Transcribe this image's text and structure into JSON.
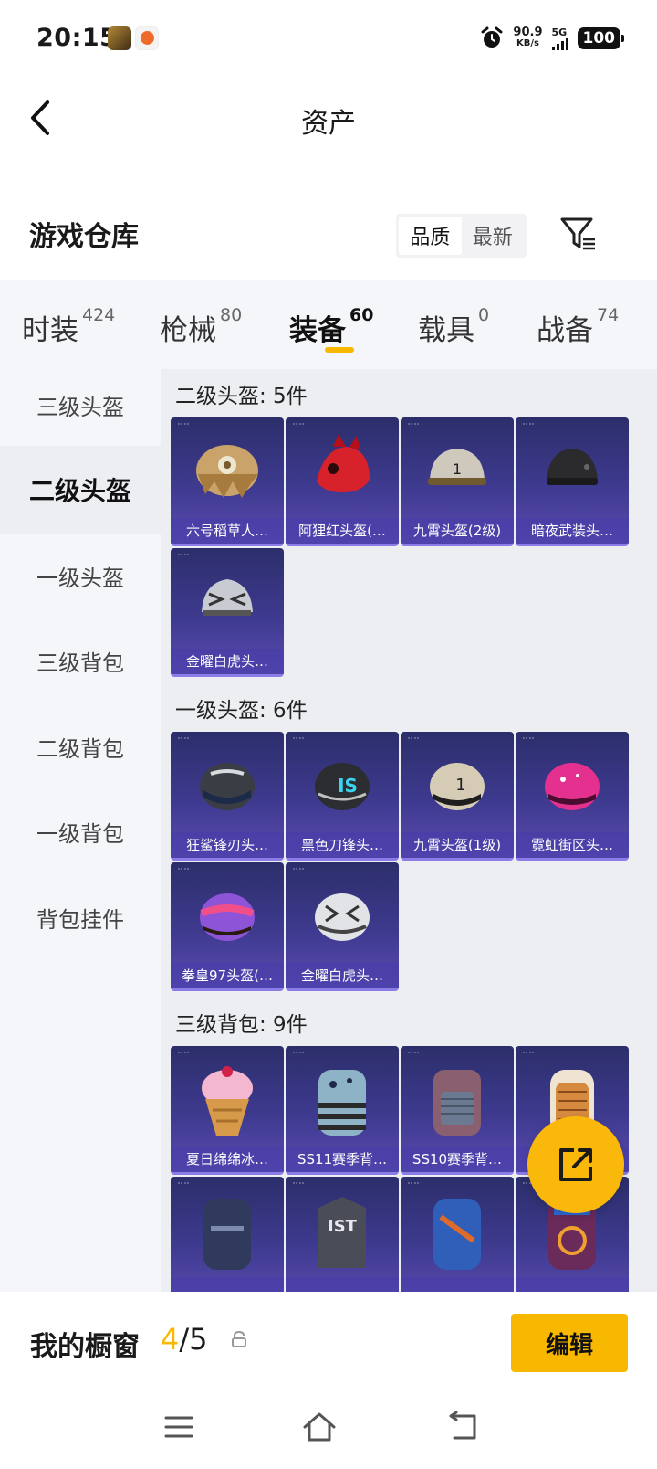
{
  "status_bar": {
    "time": "20:15",
    "net_speed_value": "90.9",
    "net_speed_unit": "KB/s",
    "network": "5G",
    "battery": "100"
  },
  "header": {
    "title": "资产"
  },
  "warehouse": {
    "title": "游戏仓库",
    "sort_options": [
      "品质",
      "最新"
    ],
    "active_sort": "品质"
  },
  "tabs": [
    {
      "label": "时装",
      "count": "424"
    },
    {
      "label": "枪械",
      "count": "80"
    },
    {
      "label": "装备",
      "count": "60"
    },
    {
      "label": "载具",
      "count": "0"
    },
    {
      "label": "战备",
      "count": "74"
    }
  ],
  "active_tab": "装备",
  "sidebar": {
    "items": [
      "三级头盔",
      "二级头盔",
      "一级头盔",
      "三级背包",
      "二级背包",
      "一级背包",
      "背包挂件"
    ],
    "active": "二级头盔"
  },
  "groups": [
    {
      "title": "二级头盔: 5件",
      "items": [
        "六号稻草人…",
        "阿狸红头盔(…",
        "九霄头盔(2级)",
        "暗夜武装头…",
        "金曜白虎头…"
      ]
    },
    {
      "title": "一级头盔: 6件",
      "items": [
        "狂鲨锋刃头…",
        "黑色刀锋头…",
        "九霄头盔(1级)",
        "霓虹街区头…",
        "拳皇97头盔(…",
        "金曜白虎头…"
      ]
    },
    {
      "title": "三级背包: 9件",
      "items": [
        "夏日绵绵冰…",
        "SS11赛季背…",
        "SS10赛季背…",
        "",
        "",
        "",
        "",
        ""
      ]
    }
  ],
  "bottom_bar": {
    "label": "我的橱窗",
    "current": "4",
    "separator": "/",
    "total": "5",
    "edit_label": "编辑"
  },
  "colors": {
    "accent": "#f8b800",
    "card_bg": "#3e3a8f"
  }
}
